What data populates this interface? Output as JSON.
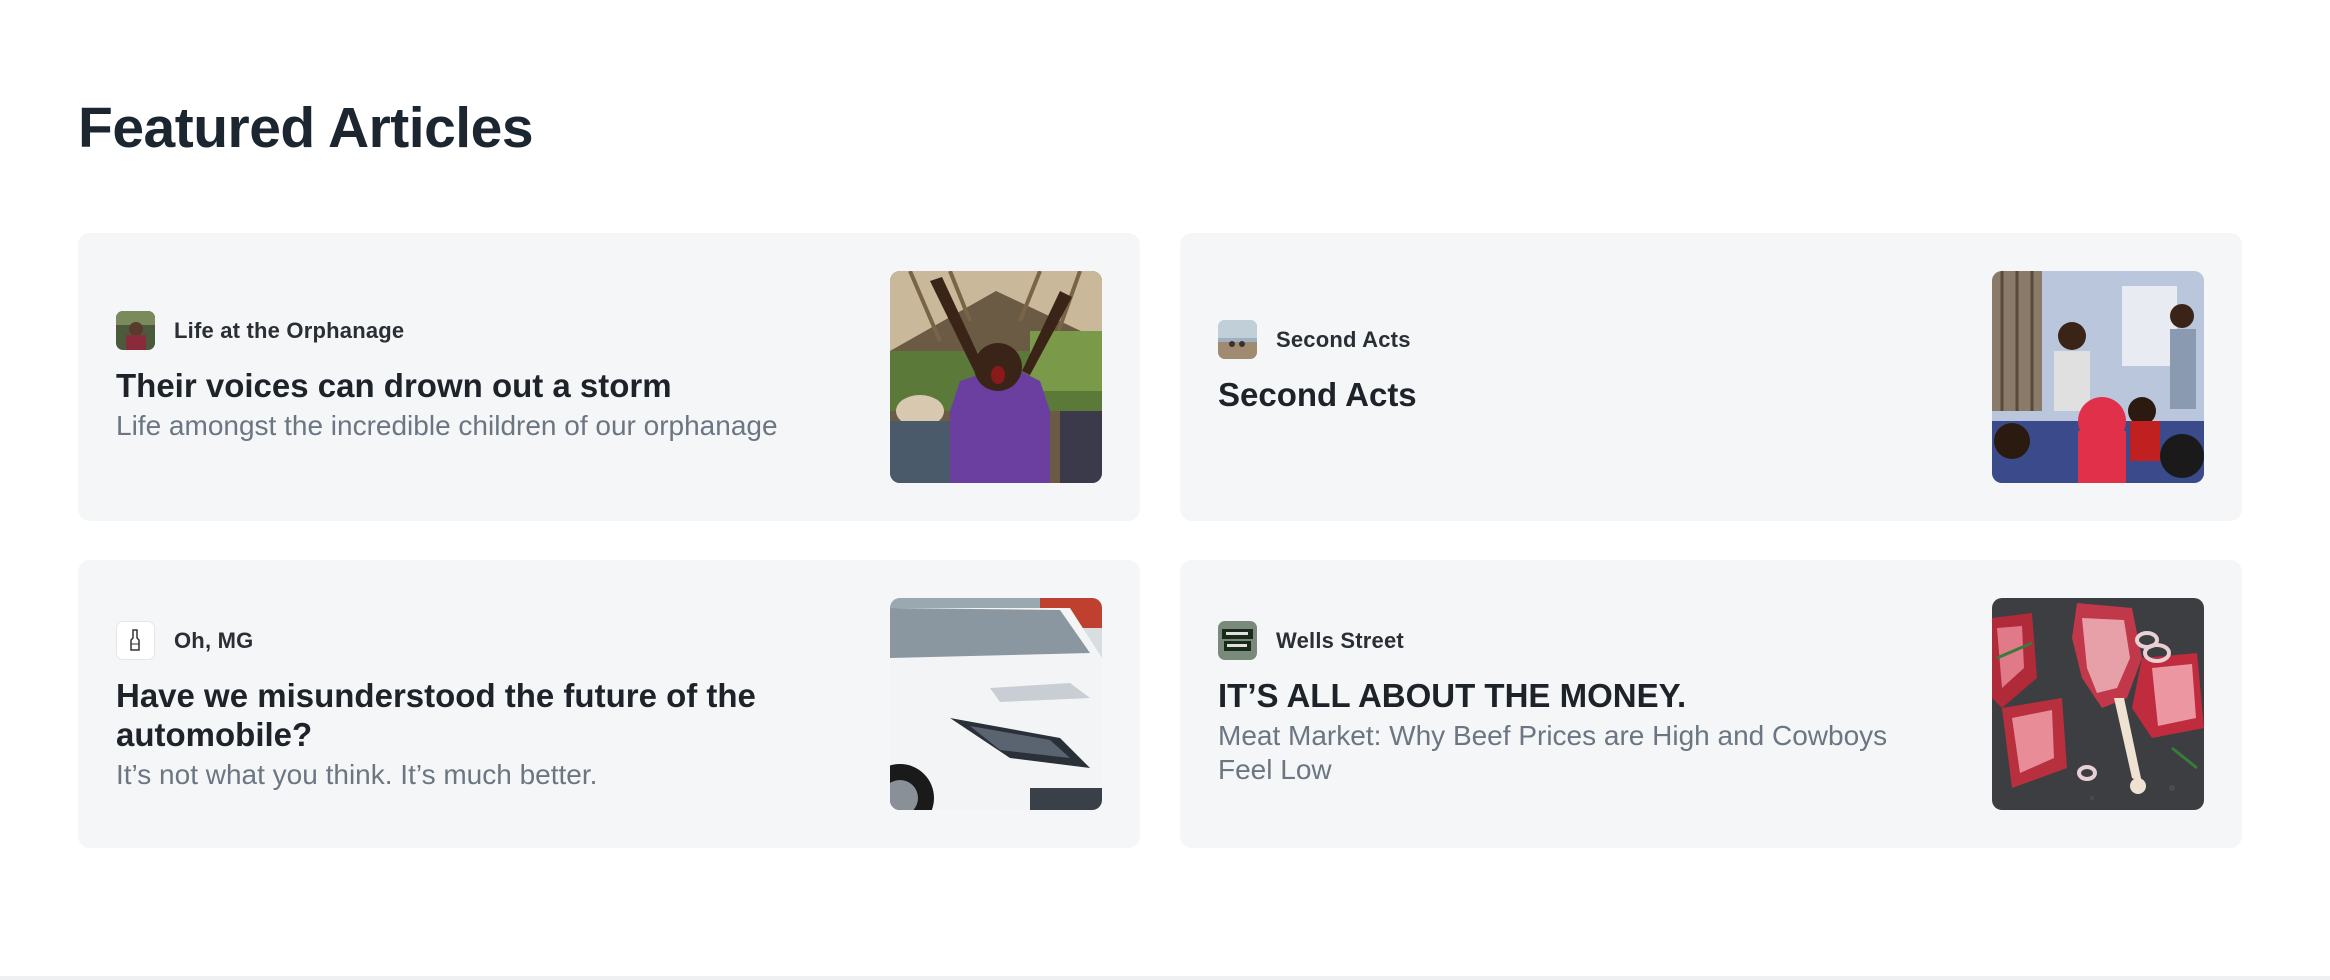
{
  "section": {
    "title": "Featured Articles"
  },
  "articles": [
    {
      "publication": "Life at the Orphanage",
      "title": "Their voices can drown out a storm",
      "subtitle": "Life amongst the incredible children of our orphanage",
      "thumbnail": "child-cheering-photo"
    },
    {
      "publication": "Second Acts",
      "title": "Second Acts",
      "subtitle": "",
      "thumbnail": "classroom-presentation-photo"
    },
    {
      "publication": "Oh, MG",
      "title": "Have we misunderstood the future of the automobile?",
      "subtitle": "It’s not what you think. It’s much better.",
      "thumbnail": "white-car-photo"
    },
    {
      "publication": "Wells Street",
      "title": "IT’S ALL ABOUT THE MONEY.",
      "subtitle": "Meat Market: Why Beef Prices are High and Cowboys Feel Low",
      "thumbnail": "raw-steaks-photo"
    }
  ],
  "colors": {
    "card_background": "#f5f6f8",
    "title": "#1d2329",
    "subtitle": "#6b7682"
  }
}
